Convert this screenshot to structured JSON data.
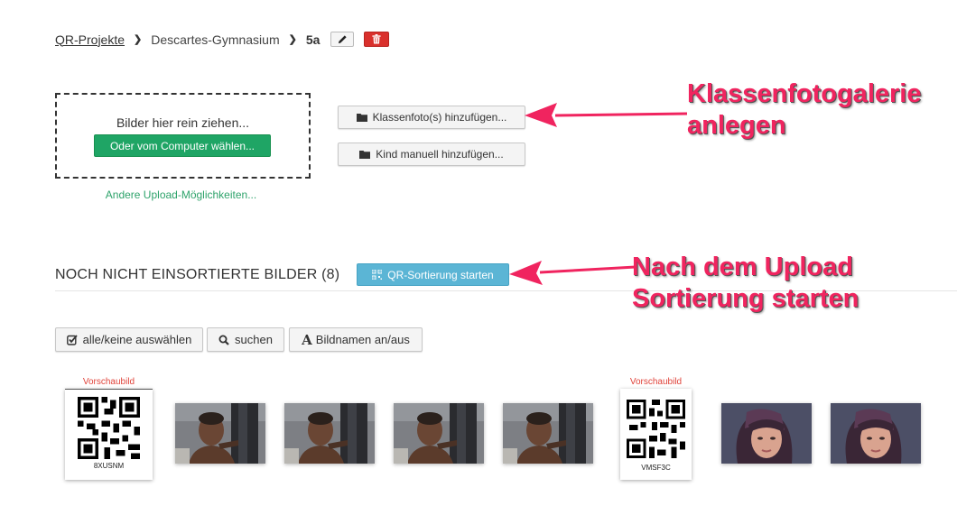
{
  "breadcrumb": {
    "root": "QR-Projekte",
    "school": "Descartes-Gymnasium",
    "current": "5a"
  },
  "upload": {
    "drop_hint": "Bilder hier rein ziehen...",
    "choose_button": "Oder vom Computer wählen...",
    "other_options": "Andere Upload-Möglichkeiten..."
  },
  "actions": {
    "add_class_photo": "Klassenfoto(s) hinzufügen...",
    "add_child": "Kind manuell hinzufügen..."
  },
  "annotations": {
    "gallery": [
      "Klassenfotogalerie",
      "anlegen"
    ],
    "sorting": [
      "Nach dem Upload",
      "Sortierung starten"
    ]
  },
  "section": {
    "title": "NOCH NICHT EINSORTIERTE BILDER (8)",
    "qr_button": "QR-Sortierung starten"
  },
  "toolbar": {
    "select_all": "alle/keine auswählen",
    "search": "suchen",
    "toggle_names": "Bildnamen an/aus"
  },
  "thumbnails": [
    {
      "type": "qr",
      "label": "Vorschaubild",
      "code": "8XUSNM"
    },
    {
      "type": "photo",
      "subject": "boy"
    },
    {
      "type": "photo",
      "subject": "boy"
    },
    {
      "type": "photo",
      "subject": "boy"
    },
    {
      "type": "photo",
      "subject": "boy"
    },
    {
      "type": "qr",
      "label": "Vorschaubild",
      "code": "VMSF3C"
    },
    {
      "type": "photo",
      "subject": "girl"
    },
    {
      "type": "photo",
      "subject": "girl"
    }
  ],
  "colors": {
    "accent_green": "#1fa565",
    "accent_blue": "#5bb5d5",
    "delete_red": "#d9302c",
    "annotation_pink": "#f0245f"
  }
}
